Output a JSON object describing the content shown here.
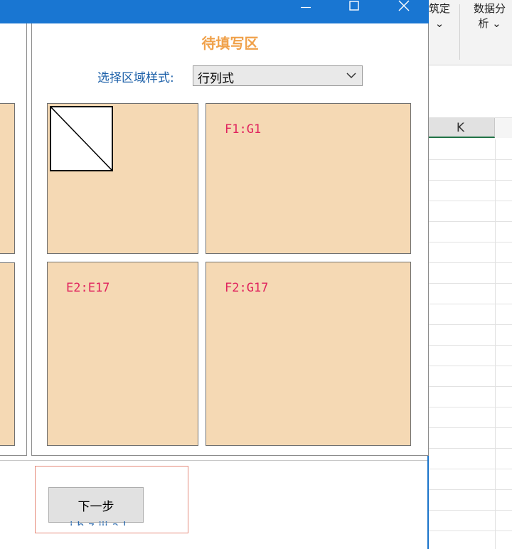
{
  "excel": {
    "ribbon_left_label": "筑定\n⌄",
    "ribbon_right_label": "数据分\n析 ⌄",
    "column_header": "K"
  },
  "dialog": {
    "titlebar_color": "#1976d2",
    "controls": {
      "minimize_icon": "minimize-icon",
      "maximize_icon": "maximize-icon",
      "close_icon": "close-icon"
    },
    "group_title": "待填写区",
    "style_label": "选择区域样式:",
    "style_select": {
      "value": "行列式",
      "options": [
        "行列式"
      ]
    },
    "tiles": {
      "top_right": "F1:G1",
      "bottom_left": "E2:E17",
      "bottom_right": "F2:G17"
    },
    "next_button": "下一步",
    "bottom_cut_text": "i-b-z-iii-a-l"
  },
  "colors": {
    "tile_fill": "#f5d9b4",
    "range_text": "#e0245e",
    "title_orange": "#f0a14a",
    "label_blue": "#1b5fa8"
  }
}
